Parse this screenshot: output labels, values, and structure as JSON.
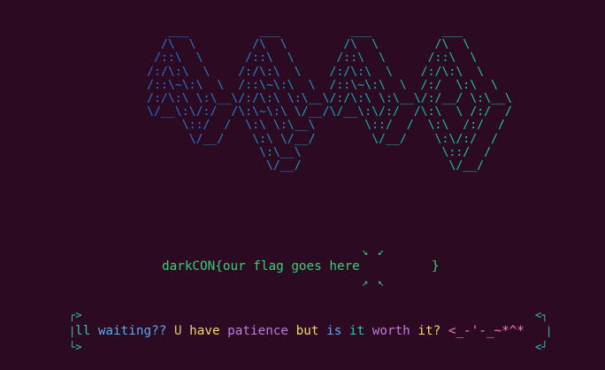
{
  "ascii_art": "   ___          ___          ___          ___     \n  /\\  \\        /\\  \\        /\\  \\        /\\  \\    \n /::\\  \\      /::\\  \\      /::\\  \\      /::\\  \\   \n/:/\\:\\  \\    /:/\\:\\  \\    /:/\\:\\  \\    /:/\\:\\  \\  \n/::\\~\\:\\  \\  /::\\~\\:\\  \\  /::\\~\\:\\  \\  /:/  \\:\\  \\ \n/:/\\:\\ \\:\\__\\/:/\\:\\ \\:\\__\\/:/\\:\\ \\:\\__\\/:/__/ \\:\\__\\\n\\/__\\:\\/:/  /\\:\\~\\:\\ \\/__/\\/__\\:\\/:/  /\\:\\  \\ /:/  /\n     \\::/  /  \\:\\ \\:\\__\\       \\::/  /  \\:\\  /:/  / \n      \\/__/    \\:\\ \\/__/        \\/__/    \\:\\/:/  /  \n                \\:\\__\\                    \\::/  /   \n                 \\/__/                     \\/__/    ",
  "flag": {
    "text": "darkCON{our flag goes here",
    "close_brace": "}"
  },
  "arrows": {
    "top_left": "↘",
    "top_right": "↙",
    "bottom_left": "↗",
    "bottom_right": "↖"
  },
  "brackets": {
    "left_top": "┌>",
    "left_mid": "|",
    "left_bottom": "└>",
    "right_top": "<┐",
    "right_mid": "|",
    "right_bottom": "<┘"
  },
  "prompt": {
    "words": [
      {
        "text": "ll",
        "color": "#2ec4b6"
      },
      {
        "text": "waiting??",
        "color": "#5aa8f0"
      },
      {
        "text": "U",
        "color": "#e5c07b"
      },
      {
        "text": "have",
        "color": "#f5d76e"
      },
      {
        "text": "patience",
        "color": "#c678dd"
      },
      {
        "text": "but",
        "color": "#f5d76e"
      },
      {
        "text": "is",
        "color": "#5aa8f0"
      },
      {
        "text": "it",
        "color": "#2ec4b6"
      },
      {
        "text": "worth",
        "color": "#c678dd"
      },
      {
        "text": "it?",
        "color": "#f5d76e"
      },
      {
        "text": "<_-'-_~*^*",
        "color": "#ff79c6"
      }
    ]
  }
}
